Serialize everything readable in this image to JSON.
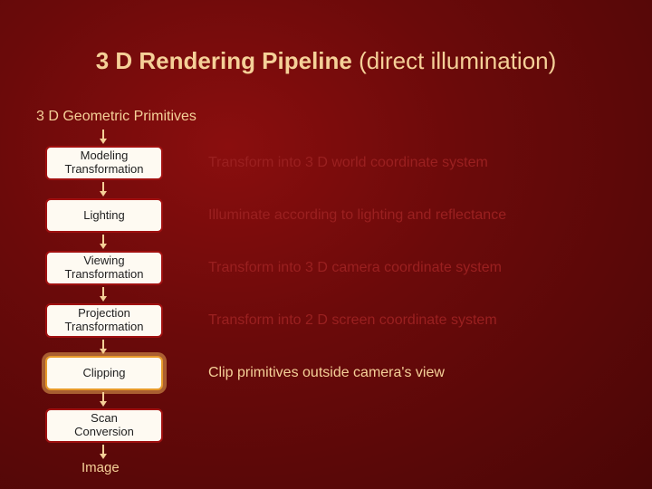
{
  "title": {
    "main": "3 D Rendering Pipeline ",
    "sub": "(direct illumination)"
  },
  "input_label": "3 D Geometric Primitives",
  "stages": [
    {
      "label": "Modeling\nTransformation",
      "desc": "Transform into 3 D world coordinate system",
      "highlight": false,
      "desc_muted": true
    },
    {
      "label": "Lighting",
      "desc": "Illuminate according to lighting and reflectance",
      "highlight": false,
      "desc_muted": true
    },
    {
      "label": "Viewing\nTransformation",
      "desc": "Transform into 3 D camera coordinate system",
      "highlight": false,
      "desc_muted": true
    },
    {
      "label": "Projection\nTransformation",
      "desc": "Transform into 2 D screen coordinate system",
      "highlight": false,
      "desc_muted": true
    },
    {
      "label": "Clipping",
      "desc": "Clip primitives outside camera's view",
      "highlight": true,
      "desc_muted": false
    },
    {
      "label": "Scan\nConversion",
      "desc": "",
      "highlight": false,
      "desc_muted": true
    }
  ],
  "output_label": "Image"
}
